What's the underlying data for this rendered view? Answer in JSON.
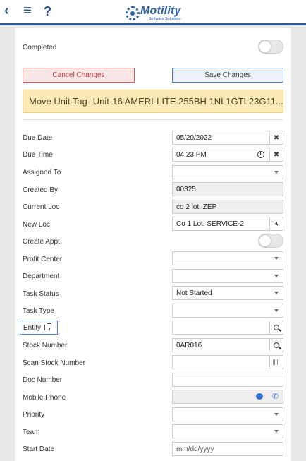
{
  "header": {
    "back_icon": "‹",
    "menu_icon": "≡",
    "help_icon": "?",
    "logo_main": "Motility",
    "logo_sub": "Software Solutions"
  },
  "completed": {
    "label": "Completed",
    "value": false
  },
  "buttons": {
    "cancel": "Cancel Changes",
    "save": "Save Changes"
  },
  "task_title": "Move Unit Tag- Unit-16 AMERI-LITE 255BH 1NL1GTL23G11...",
  "fields": {
    "due_date": {
      "label": "Due Date",
      "value": "05/20/2022",
      "clear": "✖"
    },
    "due_time": {
      "label": "Due Time",
      "value": "04:23 PM",
      "clear": "✖"
    },
    "assigned_to": {
      "label": "Assigned To",
      "value": ""
    },
    "created_by": {
      "label": "Created By",
      "value": "00325"
    },
    "current_loc": {
      "label": "Current Loc",
      "value": "co 2 lot. ZEP"
    },
    "new_loc": {
      "label": "New Loc",
      "value": "Co 1 Lot. SERVICE-2"
    },
    "create_appt": {
      "label": "Create Appt",
      "value": false
    },
    "profit_center": {
      "label": "Profit Center",
      "value": ""
    },
    "department": {
      "label": "Department",
      "value": ""
    },
    "task_status": {
      "label": "Task Status",
      "value": "Not Started"
    },
    "task_type": {
      "label": "Task Type",
      "value": ""
    },
    "entity": {
      "label": "Entity",
      "value": ""
    },
    "stock_number": {
      "label": "Stock Number",
      "value": "0AR016"
    },
    "scan_stock_number": {
      "label": "Scan Stock Number",
      "value": ""
    },
    "doc_number": {
      "label": "Doc Number",
      "value": ""
    },
    "mobile_phone": {
      "label": "Mobile Phone",
      "value": ""
    },
    "priority": {
      "label": "Priority",
      "value": ""
    },
    "team": {
      "label": "Team",
      "value": ""
    },
    "start_date": {
      "label": "Start Date",
      "placeholder": "mm/dd/yyyy"
    }
  },
  "colors": {
    "accent": "#2a5ea8",
    "cancel_border": "#e0535b",
    "save_border": "#4a7fd1",
    "title_bg": "#fbeab6"
  }
}
